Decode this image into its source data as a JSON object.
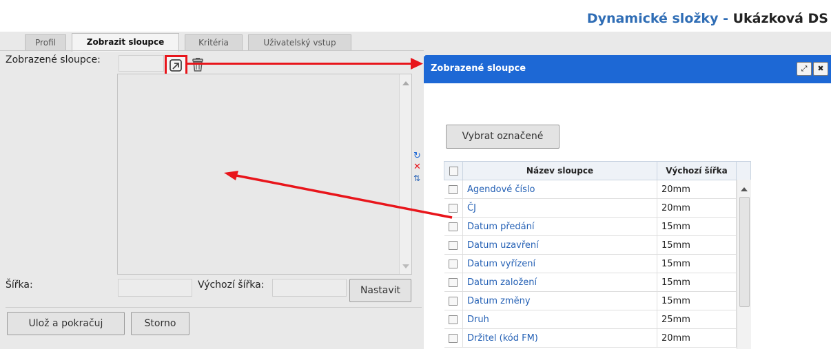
{
  "header": {
    "title_main": "Dynamické složky",
    "title_sep": " - ",
    "title_sub": "Ukázková DS"
  },
  "tabs": [
    {
      "label": "Profil",
      "active": false
    },
    {
      "label": "Zobrazit sloupce",
      "active": true
    },
    {
      "label": "Kritéria",
      "active": false
    },
    {
      "label": "Uživatelský vstup",
      "active": false
    }
  ],
  "form": {
    "displayed_columns_label": "Zobrazené sloupce:",
    "width_label": "Šířka:",
    "default_width_label": "Výchozí šířka:",
    "set_button": "Nastavit",
    "save_button": "Ulož a pokračuj",
    "cancel_button": "Storno"
  },
  "dialog": {
    "title": "Zobrazené sloupce",
    "select_button": "Vybrat označené",
    "col_name_header": "Název sloupce",
    "col_width_header": "Výchozí šířka",
    "rows": [
      {
        "name": "Agendové číslo",
        "width": "20mm"
      },
      {
        "name": "ČJ",
        "width": "20mm"
      },
      {
        "name": "Datum předání",
        "width": "15mm"
      },
      {
        "name": "Datum uzavření",
        "width": "15mm"
      },
      {
        "name": "Datum vyřízení",
        "width": "15mm"
      },
      {
        "name": "Datum založení",
        "width": "15mm"
      },
      {
        "name": "Datum změny",
        "width": "15mm"
      },
      {
        "name": "Druh",
        "width": "25mm"
      },
      {
        "name": "Držitel (kód FM)",
        "width": "20mm"
      }
    ]
  },
  "colors": {
    "accent": "#1d68d5",
    "link": "#2561b5",
    "annotation": "#e8151b"
  }
}
